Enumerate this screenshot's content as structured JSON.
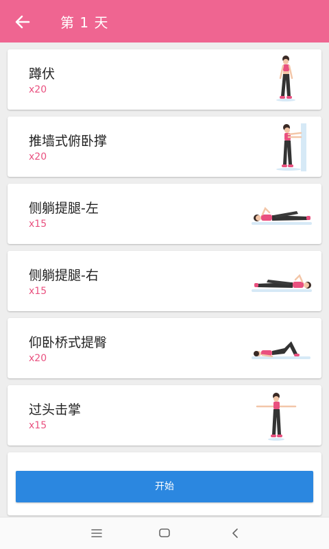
{
  "header": {
    "title": "第 1 天",
    "back_icon": "arrow-left-icon",
    "color": "#ef6591"
  },
  "exercises": [
    {
      "name": "蹲伏",
      "reps": "x20",
      "icon": "squat-illustration"
    },
    {
      "name": "推墙式俯卧撑",
      "reps": "x20",
      "icon": "wall-pushup-illustration"
    },
    {
      "name": "侧躺提腿-左",
      "reps": "x15",
      "icon": "side-leg-lift-left-illustration"
    },
    {
      "name": "侧躺提腿-右",
      "reps": "x15",
      "icon": "side-leg-lift-right-illustration"
    },
    {
      "name": "仰卧桥式提臀",
      "reps": "x20",
      "icon": "glute-bridge-illustration"
    },
    {
      "name": "过头击掌",
      "reps": "x15",
      "icon": "overhead-clap-illustration"
    }
  ],
  "start_button": {
    "label": "开始",
    "color": "#2b87e0"
  },
  "navbar": {
    "icons": [
      "menu-icon",
      "home-icon",
      "back-icon"
    ]
  }
}
